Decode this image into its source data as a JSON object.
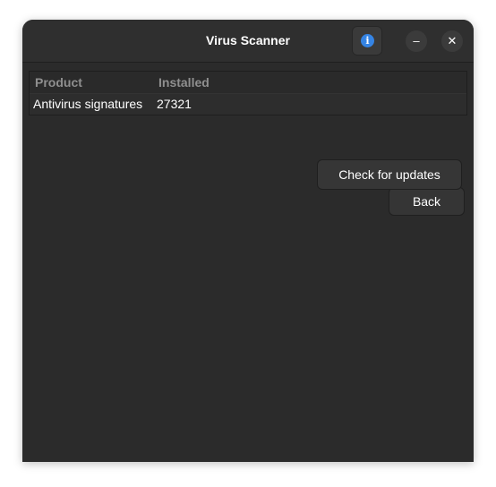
{
  "window": {
    "title": "Virus Scanner",
    "minimize_glyph": "–",
    "close_glyph": "✕",
    "info_glyph": "i"
  },
  "table": {
    "columns": [
      "Product",
      "Installed"
    ],
    "rows": [
      [
        "Antivirus signatures",
        "27321"
      ]
    ]
  },
  "buttons": {
    "check_updates": "Check for updates",
    "back": "Back"
  },
  "icons": {
    "info": "info-icon",
    "minimize": "minimize-icon",
    "close": "close-icon"
  },
  "colors": {
    "accent": "#3584e4",
    "window_bg": "#2c2c2c"
  }
}
